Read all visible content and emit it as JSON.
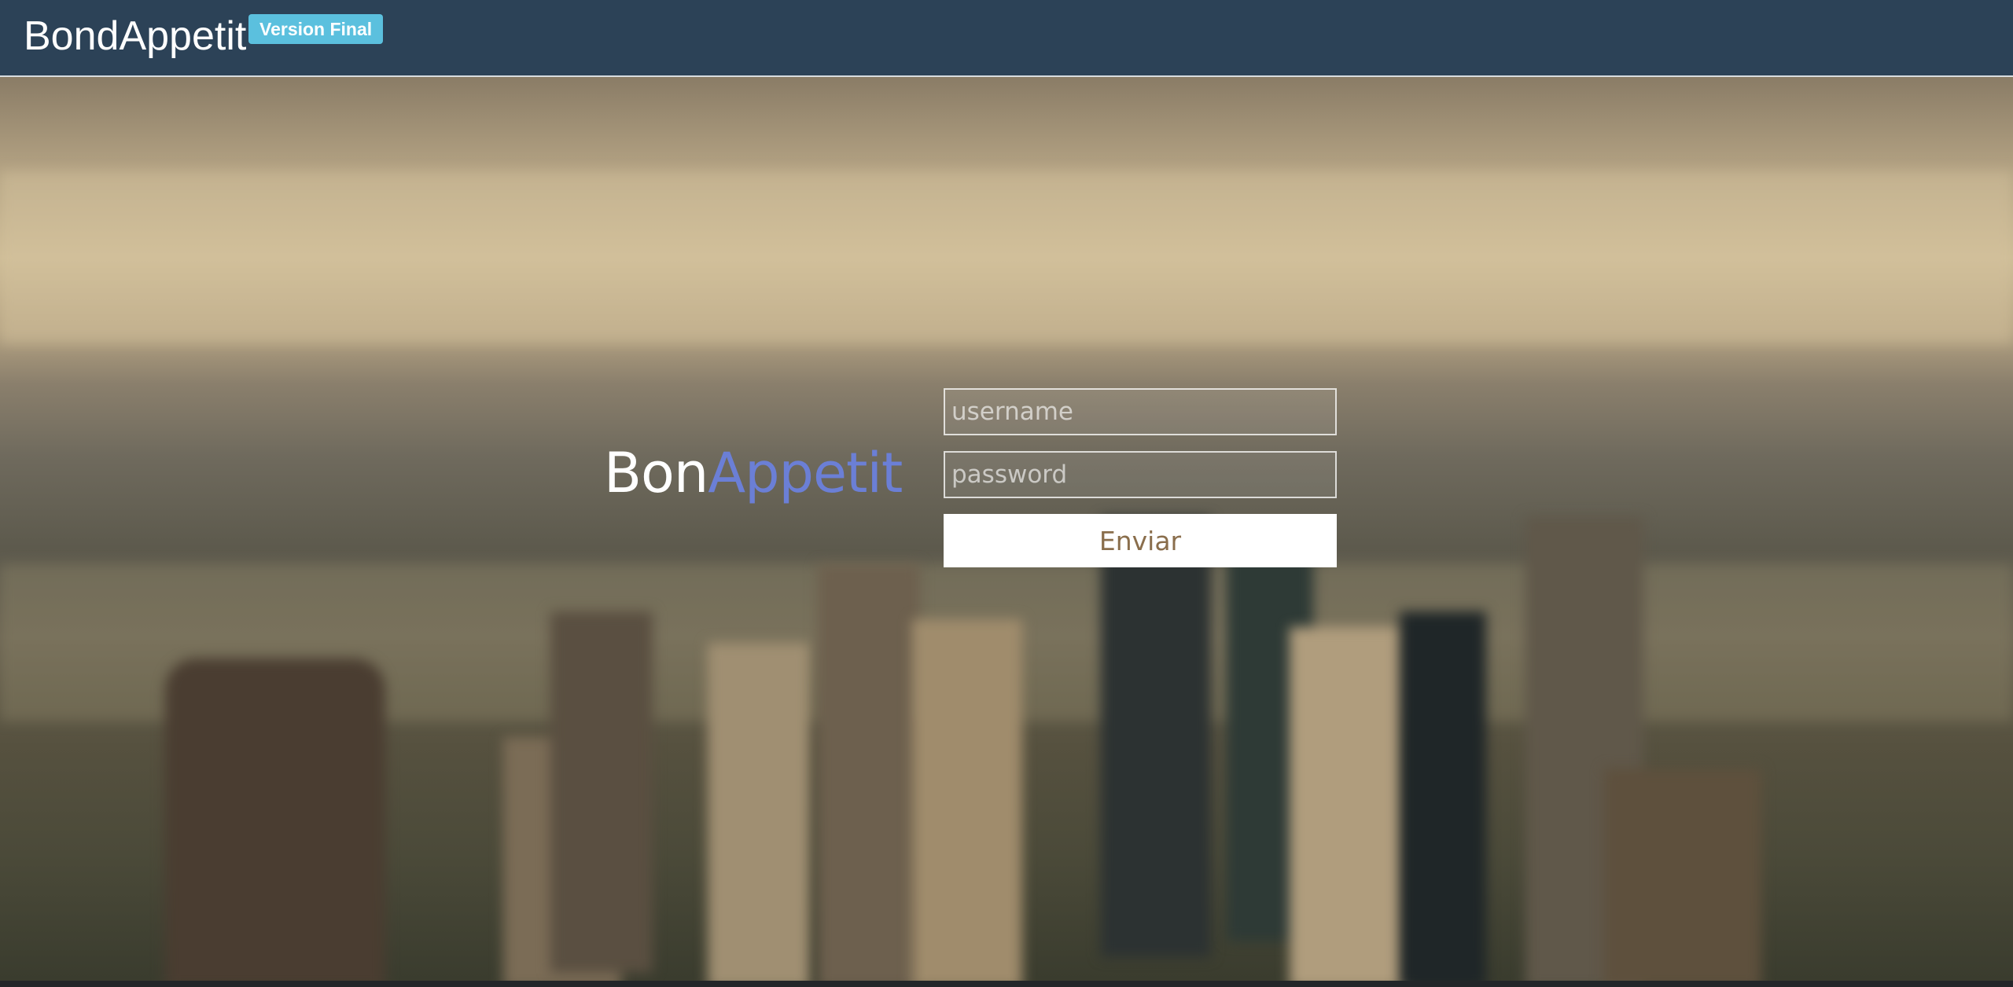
{
  "navbar": {
    "brand": "BondAppetit",
    "badge": "Version Final"
  },
  "login": {
    "logo_part1": "Bon",
    "logo_part2": "Appetit",
    "username_placeholder": "username",
    "password_placeholder": "password",
    "submit_label": "Enviar"
  },
  "colors": {
    "navbar_bg": "#2c4257",
    "badge_bg": "#5bc0de",
    "logo_accent": "#6b7fd6",
    "button_text": "#8a6e4c"
  }
}
